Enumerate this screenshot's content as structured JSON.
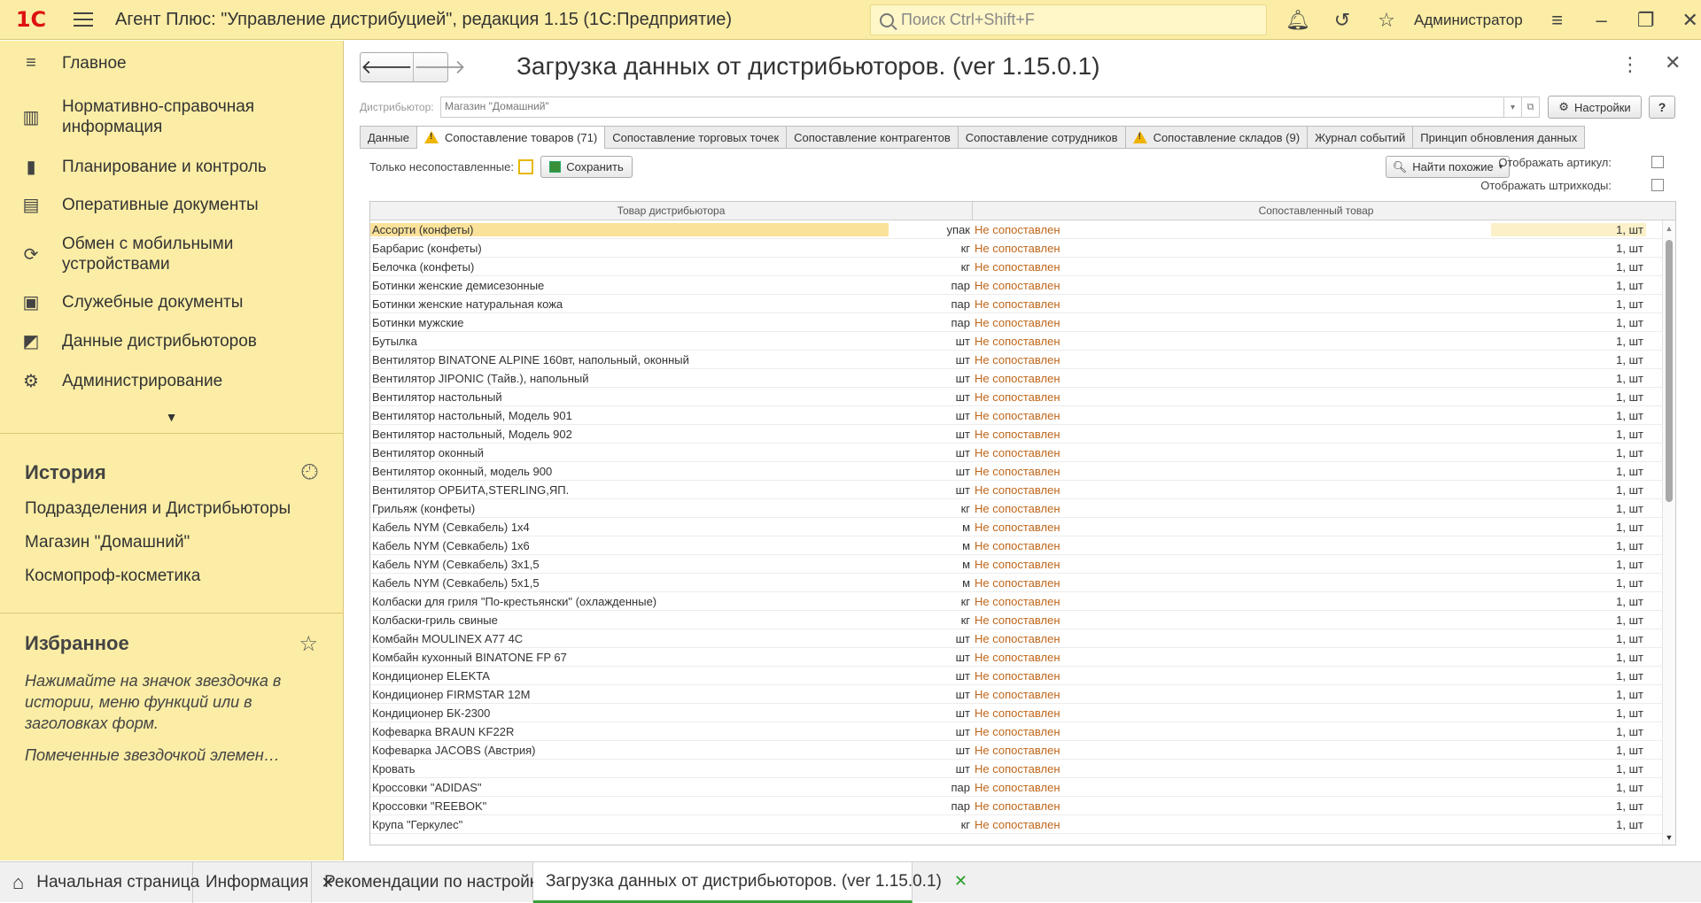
{
  "app": {
    "logo": "1С",
    "title": "Агент Плюс: \"Управление дистрибуцией\", редакция 1.15  (1С:Предприятие)",
    "search_placeholder": "Поиск Ctrl+Shift+F",
    "user": "Администратор"
  },
  "sidebar": {
    "items": [
      {
        "label": "Главное",
        "icon": "menu-icon"
      },
      {
        "label": "Нормативно-справочная информация",
        "icon": "catalog-icon"
      },
      {
        "label": "Планирование и контроль",
        "icon": "chart-icon"
      },
      {
        "label": "Оперативные документы",
        "icon": "documents-icon"
      },
      {
        "label": "Обмен с мобильными устройствами",
        "icon": "sync-icon"
      },
      {
        "label": "Служебные документы",
        "icon": "service-docs-icon"
      },
      {
        "label": "Данные дистрибьюторов",
        "icon": "distributor-data-icon"
      },
      {
        "label": "Администрирование",
        "icon": "gear-icon"
      }
    ],
    "history": {
      "title": "История",
      "items": [
        "Подразделения и Дистрибьюторы",
        "Магазин \"Домашний\"",
        "Космопроф-косметика"
      ]
    },
    "favorites": {
      "title": "Избранное",
      "text1": "Нажимайте на значок звездочка в истории, меню функций или в заголовках форм.",
      "text2": "Помеченные звездочкой элемен…"
    }
  },
  "form": {
    "title": "Загрузка данных от дистрибьюторов. (ver 1.15.0.1)",
    "distributor_label": "Дистрибьютор:",
    "distributor_value": "Магазин \"Домашний\"",
    "settings_label": "Настройки",
    "help_label": "?",
    "tabs": [
      {
        "label": "Данные",
        "warn": false,
        "active": false
      },
      {
        "label": "Сопоставление товаров (71)",
        "warn": true,
        "active": true
      },
      {
        "label": "Сопоставление торговых точек",
        "warn": false,
        "active": false
      },
      {
        "label": "Сопоставление контрагентов",
        "warn": false,
        "active": false
      },
      {
        "label": "Сопоставление сотрудников",
        "warn": false,
        "active": false
      },
      {
        "label": "Сопоставление складов (9)",
        "warn": true,
        "active": false
      },
      {
        "label": "Журнал событий",
        "warn": false,
        "active": false
      },
      {
        "label": "Принцип обновления данных",
        "warn": false,
        "active": false
      }
    ],
    "only_unmatched_label": "Только несопоставленные:",
    "save_label": "Сохранить",
    "find_similar_label": "Найти похожие",
    "show_article_label": "Отображать артикул:",
    "show_barcodes_label": "Отображать штрихкоды:",
    "table": {
      "col1": "Товар дистрибьютора",
      "col2": "Сопоставленный товар",
      "status": "Не сопоставлен",
      "rows": [
        {
          "name": "Ассорти (конфеты)",
          "unit": "упак",
          "qty": "1, шт"
        },
        {
          "name": "Барбарис (конфеты)",
          "unit": "кг",
          "qty": "1, шт"
        },
        {
          "name": "Белочка (конфеты)",
          "unit": "кг",
          "qty": "1, шт"
        },
        {
          "name": "Ботинки женские демисезонные",
          "unit": "пар",
          "qty": "1, шт"
        },
        {
          "name": "Ботинки женские натуральная кожа",
          "unit": "пар",
          "qty": "1, шт"
        },
        {
          "name": "Ботинки мужские",
          "unit": "пар",
          "qty": "1, шт"
        },
        {
          "name": "Бутылка",
          "unit": "шт",
          "qty": "1, шт"
        },
        {
          "name": "Вентилятор BINATONE ALPINE 160вт, напольный, оконный",
          "unit": "шт",
          "qty": "1, шт"
        },
        {
          "name": "Вентилятор JIPONIC (Тайв.), напольный",
          "unit": "шт",
          "qty": "1, шт"
        },
        {
          "name": "Вентилятор настольный",
          "unit": "шт",
          "qty": "1, шт"
        },
        {
          "name": "Вентилятор настольный, Модель 901",
          "unit": "шт",
          "qty": "1, шт"
        },
        {
          "name": "Вентилятор настольный, Модель 902",
          "unit": "шт",
          "qty": "1, шт"
        },
        {
          "name": "Вентилятор оконный",
          "unit": "шт",
          "qty": "1, шт"
        },
        {
          "name": "Вентилятор оконный, модель 900",
          "unit": "шт",
          "qty": "1, шт"
        },
        {
          "name": "Вентилятор ОРБИТА,STERLING,ЯП.",
          "unit": "шт",
          "qty": "1, шт"
        },
        {
          "name": "Грильяж (конфеты)",
          "unit": "кг",
          "qty": "1, шт"
        },
        {
          "name": "Кабель NYM (Севкабель) 1х4",
          "unit": "м",
          "qty": "1, шт"
        },
        {
          "name": "Кабель NYM (Севкабель) 1х6",
          "unit": "м",
          "qty": "1, шт"
        },
        {
          "name": "Кабель NYM (Севкабель) 3х1,5",
          "unit": "м",
          "qty": "1, шт"
        },
        {
          "name": "Кабель NYM (Севкабель) 5х1,5",
          "unit": "м",
          "qty": "1, шт"
        },
        {
          "name": "Колбаски для гриля \"По-крестьянски\" (охлажденные)",
          "unit": "кг",
          "qty": "1, шт"
        },
        {
          "name": "Колбаски-гриль свиные",
          "unit": "кг",
          "qty": "1, шт"
        },
        {
          "name": "Комбайн MOULINEX  A77 4C",
          "unit": "шт",
          "qty": "1, шт"
        },
        {
          "name": "Комбайн кухонный BINATONE FP 67",
          "unit": "шт",
          "qty": "1, шт"
        },
        {
          "name": "Кондиционер ELEKTA",
          "unit": "шт",
          "qty": "1, шт"
        },
        {
          "name": "Кондиционер FIRMSTAR 12M",
          "unit": "шт",
          "qty": "1, шт"
        },
        {
          "name": "Кондиционер БК-2300",
          "unit": "шт",
          "qty": "1, шт"
        },
        {
          "name": "Кофеварка BRAUN KF22R",
          "unit": "шт",
          "qty": "1, шт"
        },
        {
          "name": "Кофеварка JACOBS (Австрия)",
          "unit": "шт",
          "qty": "1, шт"
        },
        {
          "name": "Кровать",
          "unit": "шт",
          "qty": "1, шт"
        },
        {
          "name": "Кроссовки \"ADIDAS\"",
          "unit": "пар",
          "qty": "1, шт"
        },
        {
          "name": "Кроссовки \"REEBOK\"",
          "unit": "пар",
          "qty": "1, шт"
        },
        {
          "name": "Крупа \"Геркулес\"",
          "unit": "кг",
          "qty": "1, шт"
        }
      ]
    }
  },
  "bottom_tabs": [
    {
      "label": "Начальная страница",
      "home": true,
      "closable": false,
      "active": false
    },
    {
      "label": "Информация",
      "home": false,
      "closable": true,
      "active": false
    },
    {
      "label": "Рекомендации по настройке",
      "home": false,
      "closable": true,
      "active": false
    },
    {
      "label": "Загрузка данных от дистрибьюторов. (ver 1.15.0.1)",
      "home": false,
      "closable": true,
      "active": true
    }
  ]
}
